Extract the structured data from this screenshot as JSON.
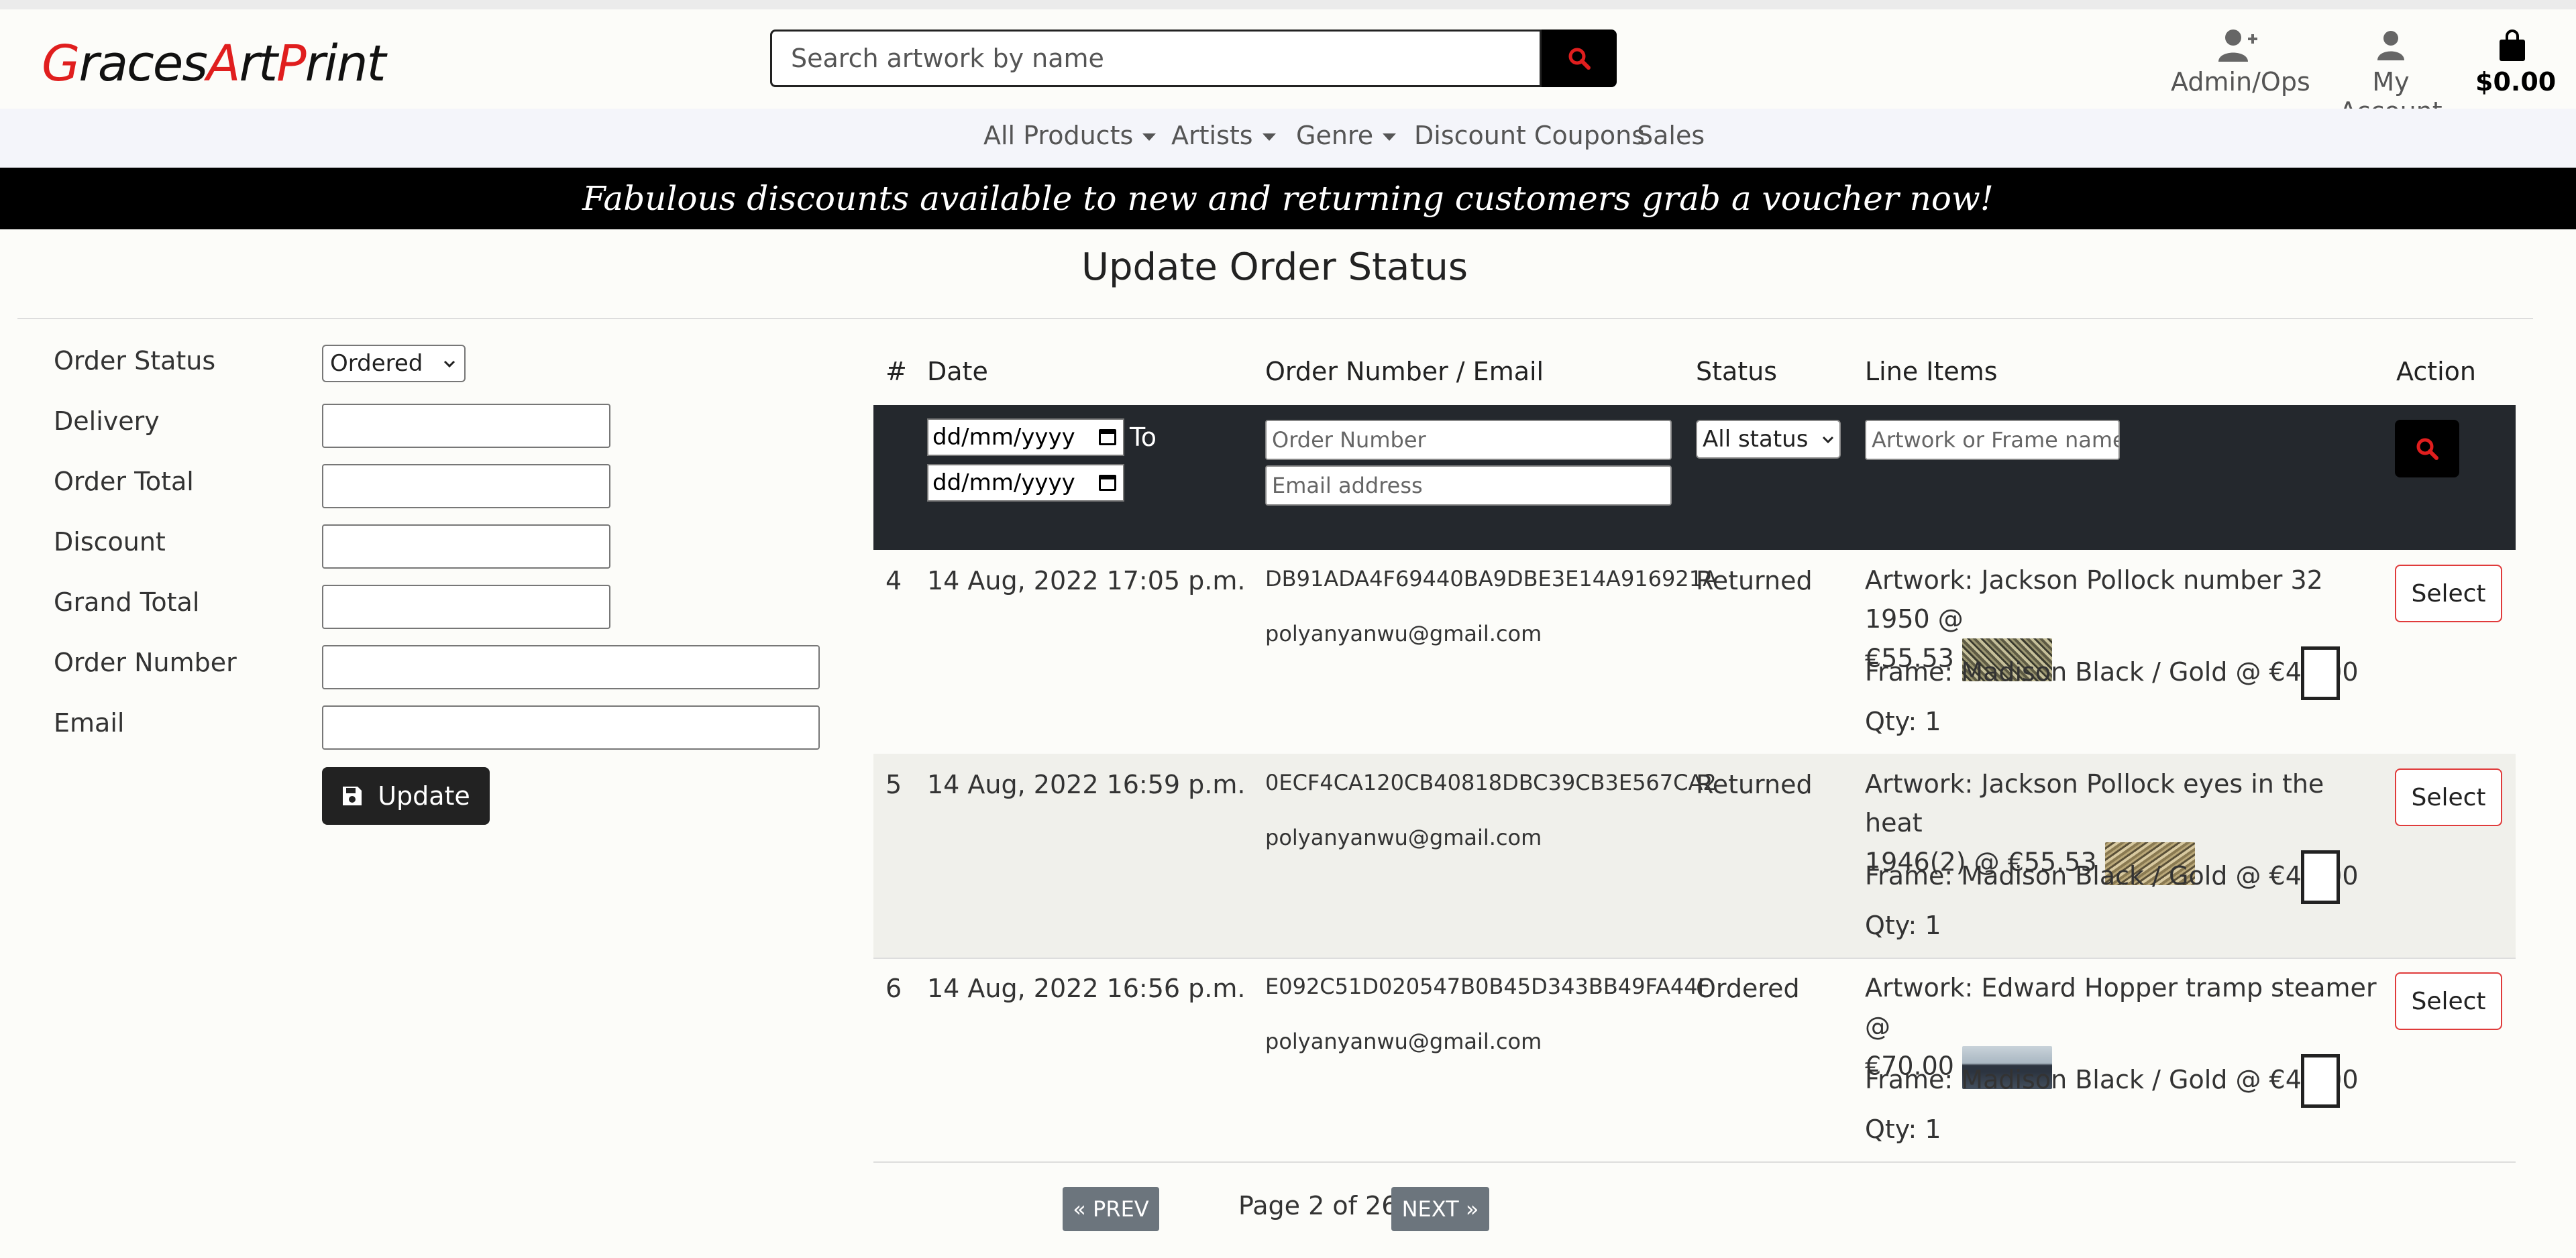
{
  "header": {
    "logo": [
      "G",
      "races",
      "A",
      "rt",
      "P",
      "rint"
    ],
    "search_placeholder": "Search artwork by name",
    "admin_label": "Admin/Ops",
    "account_label": "My Account",
    "cart_total": "$0.00"
  },
  "nav": {
    "items": [
      "All Products",
      "Artists",
      "Genre",
      "Discount Coupons",
      "Sales"
    ]
  },
  "banner": "Fabulous discounts available to new and returning customers grab a voucher now!",
  "page_title": "Update Order Status",
  "form": {
    "order_status_label": "Order Status",
    "order_status_value": "Ordered",
    "delivery_label": "Delivery",
    "order_total_label": "Order Total",
    "discount_label": "Discount",
    "grand_total_label": "Grand Total",
    "order_number_label": "Order Number",
    "email_label": "Email",
    "update_label": "Update"
  },
  "table": {
    "headers": [
      "#",
      "Date",
      "Order Number / Email",
      "Status",
      "Line Items",
      "Action"
    ],
    "filters": {
      "date_placeholder": "dd/mm/yyyy",
      "to_label": "To",
      "order_number_placeholder": "Order Number",
      "email_placeholder": "Email address",
      "status_value": "All status",
      "line_items_placeholder": "Artwork or Frame name"
    },
    "rows": [
      {
        "num": "4",
        "date": "14 Aug, 2022 17:05 p.m.",
        "order_number": "DB91ADA4F69440BA9DBE3E14A916921A",
        "email": "polyanyanwu@gmail.com",
        "status": "Returned",
        "artwork_line1": "Artwork: Jackson Pollock number 32 1950 @",
        "artwork_line2": "€55.53",
        "frame": "Frame: Madison Black / Gold @ €42.00",
        "qty": "Qty: 1",
        "action": "Select"
      },
      {
        "num": "5",
        "date": "14 Aug, 2022 16:59 p.m.",
        "order_number": "0ECF4CA120CB40818DBC39CB3E567CA2",
        "email": "polyanyanwu@gmail.com",
        "status": "Returned",
        "artwork_line1": "Artwork: Jackson Pollock eyes in the heat",
        "artwork_line2": "1946(2) @ €55.53",
        "frame": "Frame: Madison Black / Gold @ €42.00",
        "qty": "Qty: 1",
        "action": "Select"
      },
      {
        "num": "6",
        "date": "14 Aug, 2022 16:56 p.m.",
        "order_number": "E092C51D020547B0B45D343BB49FA44F",
        "email": "polyanyanwu@gmail.com",
        "status": "Ordered",
        "artwork_line1": "Artwork: Edward Hopper tramp steamer @",
        "artwork_line2": "€70.00",
        "frame": "Frame: Madison Black / Gold @ €42.00",
        "qty": "Qty: 1",
        "action": "Select"
      }
    ]
  },
  "pagination": {
    "prev": "« PREV",
    "page_text": "Page 2 of 26",
    "next": "NEXT »"
  },
  "colors": {
    "brand_red": "#e01e1e",
    "banner_bg": "#000000",
    "filter_bg": "#24282d",
    "select_border": "#e03b3b",
    "pager_bg": "#6c757d"
  }
}
